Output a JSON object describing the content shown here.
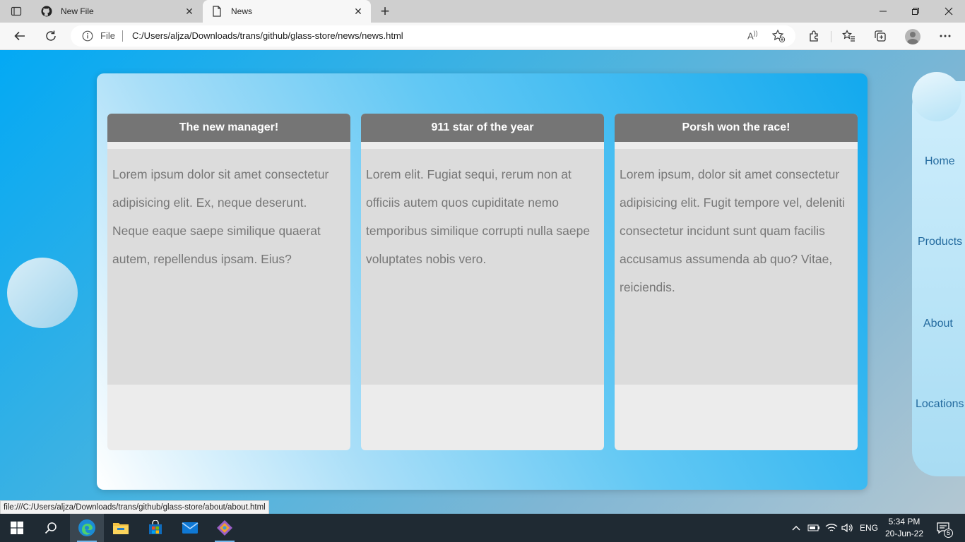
{
  "browser": {
    "tabs": [
      {
        "title": "New File",
        "icon": "github-icon",
        "active": false
      },
      {
        "title": "News",
        "icon": "page-icon",
        "active": true
      }
    ],
    "address": {
      "scheme_label": "File",
      "url": "C:/Users/aljza/Downloads/trans/github/glass-store/news/news.html",
      "read_aloud": "A"
    },
    "status_url": "file:///C:/Users/aljza/Downloads/trans/github/glass-store/about/about.html"
  },
  "page": {
    "cards": [
      {
        "title": "The new manager!",
        "text": "Lorem ipsum dolor sit amet consectetur adipisicing elit. Ex, neque deserunt. Neque eaque saepe similique quaerat autem, repellendus ipsam. Eius?"
      },
      {
        "title": "911 star of the year",
        "text": "Lorem elit. Fugiat sequi, rerum non at officiis autem quos cupiditate nemo temporibus similique corrupti nulla saepe voluptates nobis vero."
      },
      {
        "title": "Porsh won the race!",
        "text": "Lorem ipsum, dolor sit amet consectetur adipisicing elit. Fugit tempore vel, deleniti consectetur incidunt sunt quam facilis accusamus assumenda ab quo? Vitae, reiciendis."
      }
    ],
    "nav": {
      "home": "Home",
      "products": "Products",
      "about": "About",
      "locations": "Locations"
    }
  },
  "taskbar": {
    "language": "ENG",
    "time": "5:34 PM",
    "date": "20-Jun-22",
    "notification_count": "5"
  },
  "colors": {
    "page_gradient_start": "#03a9f4",
    "card_header": "#757575",
    "card_body": "#dcdcdc",
    "nav_link": "#246b9f"
  }
}
